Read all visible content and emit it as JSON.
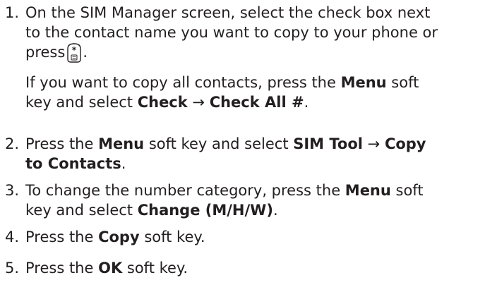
{
  "steps": [
    {
      "number": "1.",
      "line1": "On the SIM Manager screen, select the check box next",
      "line2": "to the contact name you want to copy to your phone or",
      "line3_pre": "press",
      "line3_post": ".",
      "key_icon": "star-key-icon",
      "note": {
        "l1_a": "If you want to copy all contacts, press the ",
        "l1_b": "Menu",
        "l1_c": " soft",
        "l2_a": "key and select ",
        "l2_b": "Check",
        "l2_c": " → ",
        "l2_d": "Check All #",
        "l2_e": "."
      }
    },
    {
      "number": "2.",
      "l1_a": "Press the ",
      "l1_b": "Menu",
      "l1_c": " soft key and select ",
      "l1_d": "SIM Tool",
      "l1_e": " → ",
      "l1_f": "Copy",
      "l2_a": "to Contacts",
      "l2_b": "."
    },
    {
      "number": "3.",
      "l1_a": "To change the number category, press the ",
      "l1_b": "Menu",
      "l1_c": " soft",
      "l2_a": "key and select ",
      "l2_b": "Change (M/H/W)",
      "l2_c": "."
    },
    {
      "number": "4.",
      "l1_a": "Press the ",
      "l1_b": "Copy",
      "l1_c": " soft key."
    },
    {
      "number": "5.",
      "l1_a": "Press the ",
      "l1_b": "OK",
      "l1_c": " soft key."
    }
  ]
}
